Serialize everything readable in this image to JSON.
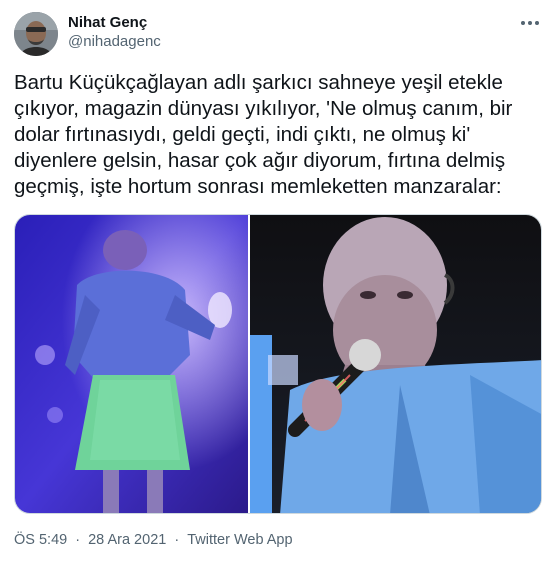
{
  "author": {
    "name": "Nihat Genç",
    "handle": "@nihadagenc"
  },
  "tweet": {
    "text": "Bartu Küçükçağlayan adlı şarkıcı sahneye yeşil etekle\nçıkıyor, magazin dünyası yıkılıyor, 'Ne olmuş canım, bir\ndolar fırtınasıydı, geldi geçti, indi çıktı, ne olmuş ki'\ndiyenlere gelsin, hasar çok ağır diyorum, fırtına delmiş\ngeçmiş, işte hortum sonrası memleketten manzaralar:"
  },
  "meta": {
    "time": "ÖS 5:49",
    "date": "28 Ara 2021",
    "source": "Twitter Web App",
    "separator": "·"
  },
  "icons": {
    "more": "more-options-icon",
    "avatar": "avatar"
  },
  "colors": {
    "text": "#0f1419",
    "secondary": "#536471",
    "border": "#cfd9de"
  }
}
